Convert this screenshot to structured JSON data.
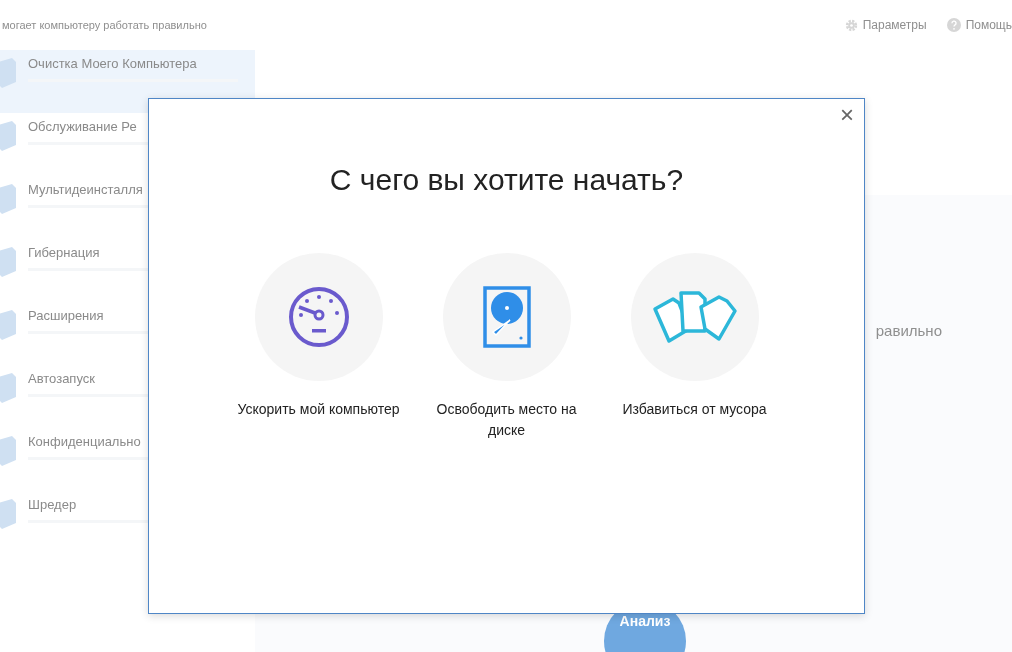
{
  "header": {
    "tagline": "могает компьютеру работать правильно",
    "links": [
      {
        "kind": "settings",
        "label": "Параметры"
      },
      {
        "kind": "help",
        "label": "Помощь"
      }
    ]
  },
  "sidebar": {
    "items": [
      {
        "label": "Очистка Моего Компьютера",
        "selected": true
      },
      {
        "label": "Обслуживание Ре",
        "selected": false
      },
      {
        "label": "Мультидеинсталля",
        "selected": false
      },
      {
        "label": "Гибернация",
        "selected": false
      },
      {
        "label": "Расширения",
        "selected": false
      },
      {
        "label": "Автозапуск",
        "selected": false
      },
      {
        "label": "Конфиденциально",
        "selected": false
      },
      {
        "label": "Шредер",
        "selected": false
      }
    ]
  },
  "main": {
    "status_fragment": "равильно",
    "analyze_button": "Анализ"
  },
  "dialog": {
    "title": "С чего вы хотите начать?",
    "close": "×",
    "options": [
      {
        "kind": "speed",
        "label": "Ускорить мой компьютер"
      },
      {
        "kind": "disk",
        "label": "Освободить место на диске"
      },
      {
        "kind": "junk",
        "label": "Избавиться от мусора"
      }
    ]
  }
}
